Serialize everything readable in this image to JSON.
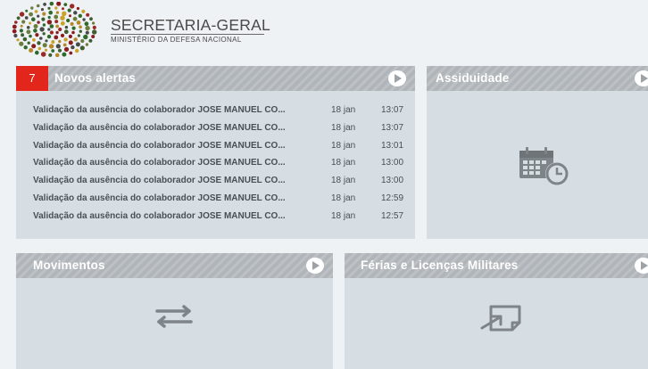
{
  "header": {
    "title": "SECRETARIA-GERAL",
    "subtitle": "MINISTÉRIO DA DEFESA NACIONAL"
  },
  "tiles": {
    "alerts": {
      "title": "Novos alertas",
      "badge": "7",
      "items": [
        {
          "text": "Validação da ausência do colaborador JOSE MANUEL CO...",
          "date": "18 jan",
          "time": "13:07"
        },
        {
          "text": "Validação da ausência do colaborador JOSE MANUEL CO...",
          "date": "18 jan",
          "time": "13:07"
        },
        {
          "text": "Validação da ausência do colaborador JOSE MANUEL CO...",
          "date": "18 jan",
          "time": "13:01"
        },
        {
          "text": "Validação da ausência do colaborador JOSE MANUEL CO...",
          "date": "18 jan",
          "time": "13:00"
        },
        {
          "text": "Validação da ausência do colaborador JOSE MANUEL CO...",
          "date": "18 jan",
          "time": "13:00"
        },
        {
          "text": "Validação da ausência do colaborador JOSE MANUEL CO...",
          "date": "18 jan",
          "time": "12:59"
        },
        {
          "text": "Validação da ausência do colaborador JOSE MANUEL CO...",
          "date": "18 jan",
          "time": "12:57"
        }
      ]
    },
    "assiduidade": {
      "title": "Assiduidade",
      "icon": "calendar-clock-icon"
    },
    "movimentos": {
      "title": "Movimentos",
      "icon": "swap-arrows-icon"
    },
    "ferias": {
      "title": "Férias e Licenças Militares",
      "icon": "leave-document-icon"
    }
  },
  "colors": {
    "badge": "#e2261c",
    "tile_header": "#b0b5ba",
    "tile_body": "#d6dde3",
    "background": "#eef2f5",
    "icon": "#7f8489"
  }
}
